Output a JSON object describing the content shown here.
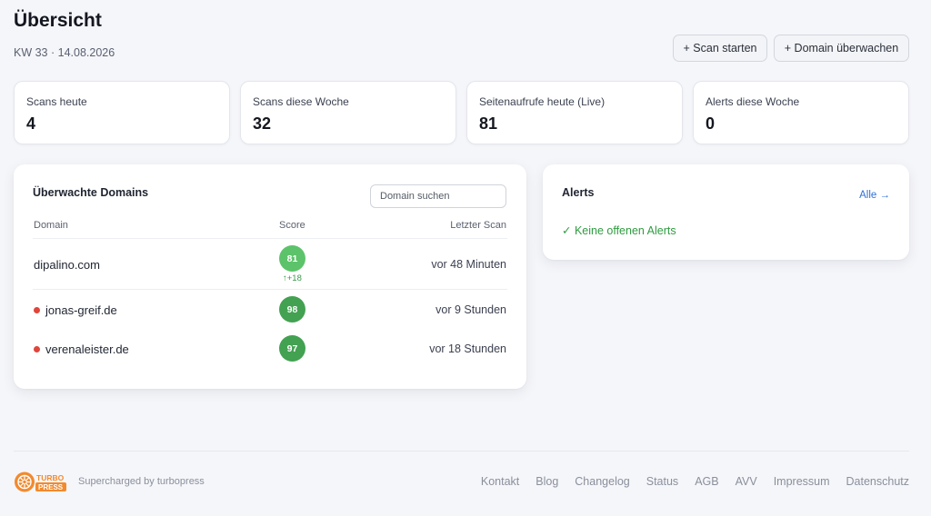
{
  "header": {
    "title": "Übersicht",
    "subtitle": "KW 33 · 14.08.2026",
    "scan_button": "+ Scan starten",
    "domain_button": "+ Domain überwachen"
  },
  "stats": [
    {
      "label": "Scans heute",
      "value": "4"
    },
    {
      "label": "Scans diese Woche",
      "value": "32"
    },
    {
      "label": "Seitenaufrufe heute (Live)",
      "value": "81"
    },
    {
      "label": "Alerts diese Woche",
      "value": "0"
    }
  ],
  "domains": {
    "title": "Überwachte Domains",
    "search_placeholder": "Domain suchen",
    "columns": {
      "domain": "Domain",
      "score": "Score",
      "last_scan": "Letzter Scan"
    },
    "rows": [
      {
        "domain": "dipalino.com",
        "score": "81",
        "delta": "↑+18",
        "last_scan": "vor 48 Minuten",
        "alert_dot": false,
        "badge_color": "#5cc36a"
      },
      {
        "domain": "jonas-greif.de",
        "score": "98",
        "delta": "",
        "last_scan": "vor 9 Stunden",
        "alert_dot": true,
        "badge_color": "#43a152"
      },
      {
        "domain": "verenaleister.de",
        "score": "97",
        "delta": "",
        "last_scan": "vor 18 Stunden",
        "alert_dot": true,
        "badge_color": "#43a152"
      }
    ]
  },
  "alerts": {
    "title": "Alerts",
    "all_link": "Alle →",
    "empty_message": "✓ Keine offenen Alerts"
  },
  "footer": {
    "logo_text_top": "TURBO",
    "logo_text_bottom": "PRESS",
    "tagline": "Supercharged by turbopress",
    "links": [
      "Kontakt",
      "Blog",
      "Changelog",
      "Status",
      "AGB",
      "AVV",
      "Impressum",
      "Datenschutz"
    ]
  },
  "colors": {
    "accent_link": "#2f6fd6",
    "success": "#2f9b41",
    "alert_dot": "#e0453a",
    "brand_orange": "#f28a2e"
  }
}
